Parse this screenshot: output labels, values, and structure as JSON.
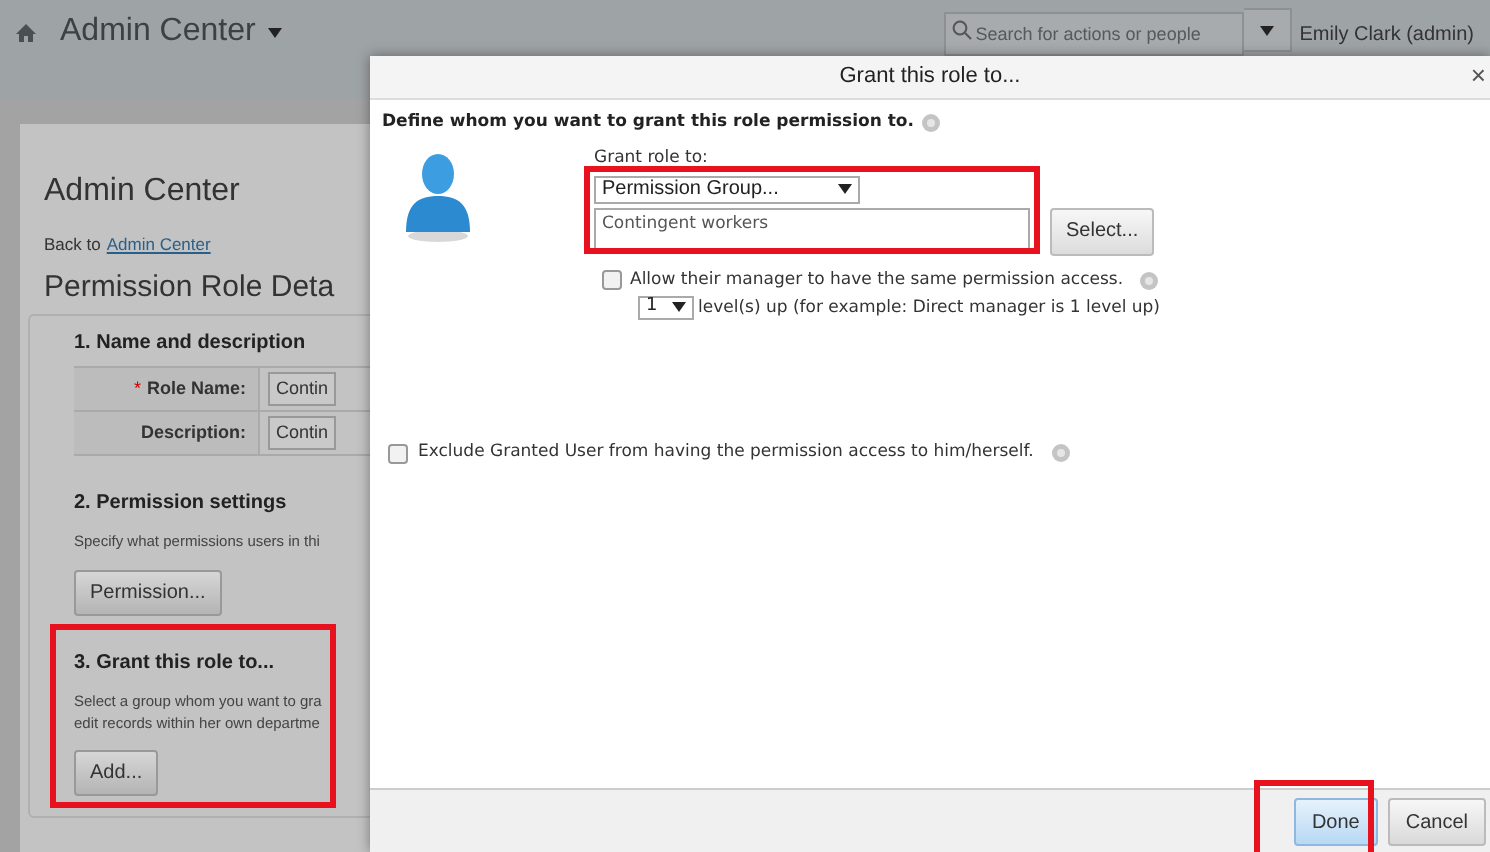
{
  "top_bar": {
    "title": "Admin Center",
    "search": {
      "placeholder": "Search for actions or people"
    },
    "user": "Emily Clark (admin)"
  },
  "page": {
    "heading": "Admin Center",
    "back_text": "Back to",
    "back_link": "Admin Center",
    "title": "Permission Role Deta",
    "sections": [
      {
        "kind": "fields",
        "title": "1. Name and description",
        "highlighted": false,
        "fields": [
          {
            "mark": "*",
            "label": "Role Name:",
            "value": "Contin"
          },
          {
            "label": "Description:",
            "value": "Contin"
          }
        ]
      },
      {
        "kind": "button",
        "title": "2. Permission settings",
        "highlighted": false,
        "lines": [
          "Specify what permissions users in thi"
        ],
        "button": "Permission..."
      },
      {
        "kind": "button",
        "title": "3. Grant this role to...",
        "highlighted": true,
        "lines": [
          "Select a group whom you want to gra",
          "edit records within her own departme"
        ],
        "button": "Add..."
      }
    ]
  },
  "dialog": {
    "title": "Grant this role to...",
    "close": "×",
    "intro": "Define whom you want to grant this role permission to.",
    "grant_to": {
      "label": "Grant role to:",
      "select": "Permission Group...",
      "value": "Contingent workers",
      "button": "Select...",
      "highlighted": true
    },
    "manager": {
      "checked": false,
      "label": "Allow their manager to have the same permission access.",
      "levels": "1",
      "levels_text": "level(s) up (for example: Direct manager is 1 level up)"
    },
    "exclude": {
      "checked": false,
      "label": "Exclude Granted User from having the permission access to him/herself."
    },
    "buttons": [
      {
        "label": "Done",
        "primary": true,
        "highlighted": true
      },
      {
        "label": "Cancel",
        "primary": false,
        "highlighted": false
      }
    ]
  }
}
